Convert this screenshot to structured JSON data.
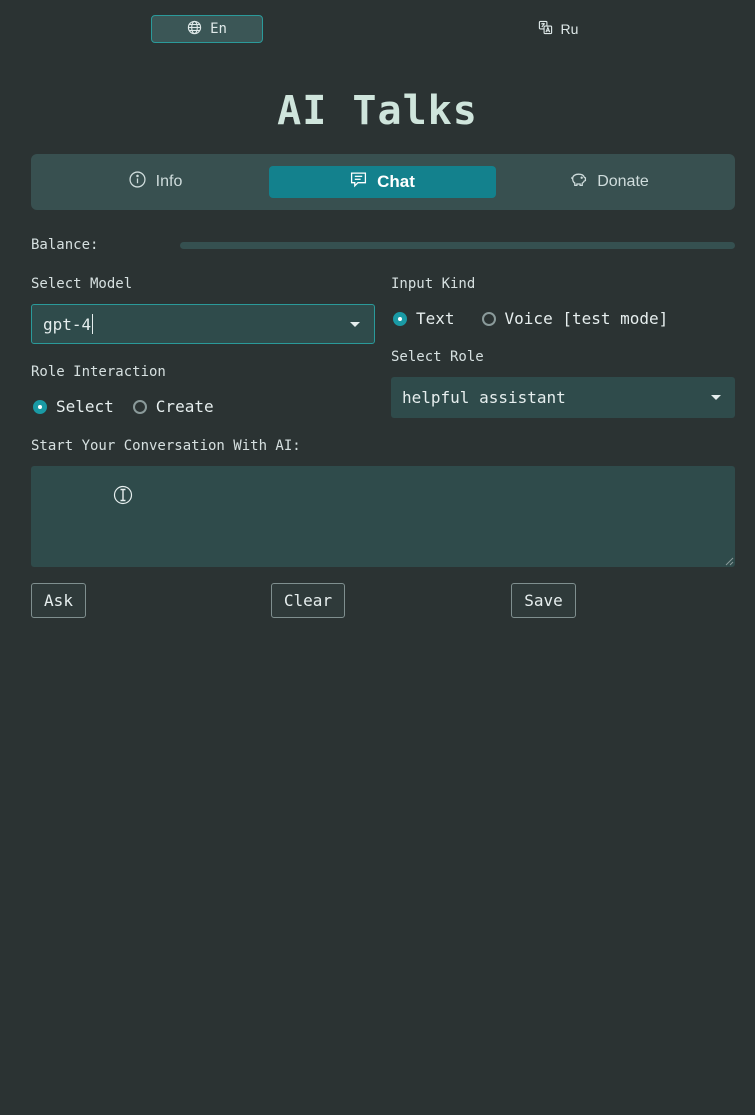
{
  "languages": {
    "en_label": "En",
    "ru_label": "Ru"
  },
  "title": "AI Talks",
  "tabs": {
    "info": "Info",
    "chat": "Chat",
    "donate": "Donate"
  },
  "balance": {
    "label": "Balance:",
    "fill_fraction": 0
  },
  "model": {
    "label": "Select Model",
    "value": "gpt-4"
  },
  "input_kind": {
    "label": "Input Kind",
    "options": [
      "Text",
      "Voice [test mode]"
    ],
    "selected": "Text"
  },
  "role_interaction": {
    "label": "Role Interaction",
    "options": [
      "Select",
      "Create"
    ],
    "selected": "Select"
  },
  "role": {
    "label": "Select Role",
    "value": "helpful assistant"
  },
  "conversation": {
    "label": "Start Your Conversation With AI:",
    "value": ""
  },
  "buttons": {
    "ask": "Ask",
    "clear": "Clear",
    "save": "Save"
  },
  "colors": {
    "background": "#2b3333",
    "accent": "#13818d",
    "panel": "#385050",
    "field": "#2f4b4b",
    "title": "#cfe5dc"
  }
}
